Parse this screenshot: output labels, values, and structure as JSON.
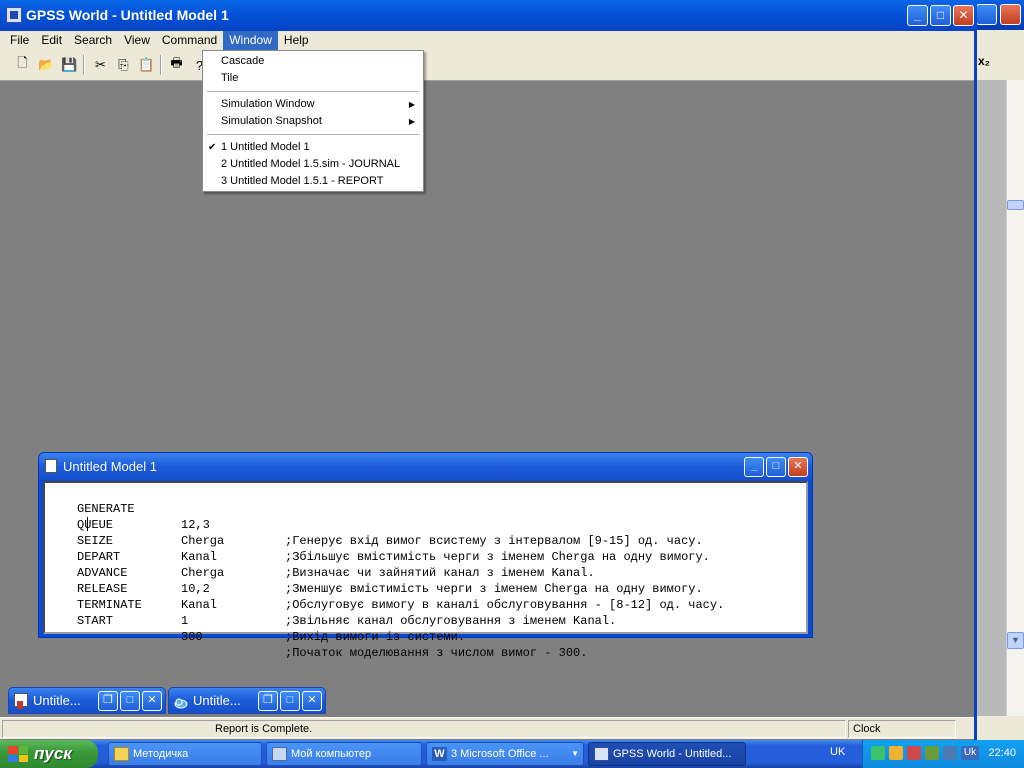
{
  "main_window": {
    "title": "GPSS World - Untitled Model 1",
    "menus": [
      "File",
      "Edit",
      "Search",
      "View",
      "Command",
      "Window",
      "Help"
    ],
    "active_menu": "Window"
  },
  "toolbar": {
    "icons": [
      "new-file-icon",
      "open-folder-icon",
      "save-icon",
      "cut-icon",
      "copy-icon",
      "paste-icon",
      "print-icon",
      "help-icon"
    ]
  },
  "window_menu": {
    "cascade": "Cascade",
    "tile": "Tile",
    "simulation_window": "Simulation Window",
    "simulation_snapshot": "Simulation Snapshot",
    "win1": "1 Untitled Model 1",
    "win2": "2 Untitled Model 1.5.sim  -  JOURNAL",
    "win3": "3 Untitled Model 1.5.1  -  REPORT",
    "checked": "1 Untitled Model 1"
  },
  "model_window": {
    "title": "Untitled Model 1",
    "lines": [
      {
        "op": "GENERATE",
        "arg": "12,3",
        "comment": ";Генерує вхід вимог всистему з інтервалом [9-15] од. часу."
      },
      {
        "op": "QUEUE",
        "arg": "Cherga",
        "comment": ";Збільшує вмістимість черги з іменем Cherga на одну вимогу."
      },
      {
        "op": "SEIZE",
        "arg": "Kanal",
        "comment": ";Визначає чи зайнятий канал з іменем Kanal."
      },
      {
        "op": "DEPART",
        "arg": "Cherga",
        "comment": ";Зменшує вмістимість черги з іменем Cherga на одну вимогу."
      },
      {
        "op": "ADVANCE",
        "arg": "10,2",
        "comment": ";Обслуговує вимогу в каналі обслуговування - [8-12] од. часу."
      },
      {
        "op": "RELEASE",
        "arg": "Kanal",
        "comment": ";Звільняє канал обслуговування з іменем Kanal."
      },
      {
        "op": "TERMINATE",
        "arg": "1",
        "comment": ";Вихід вимоги із системи."
      },
      {
        "op": "START",
        "arg": "300",
        "comment": ";Початок моделювання з числом вимог - 300."
      }
    ]
  },
  "minimized": [
    {
      "title": "Untitle...",
      "icon": "report-icon"
    },
    {
      "title": "Untitle...",
      "icon": "simulation-icon"
    }
  ],
  "status": {
    "message": "Report is Complete.",
    "clock_label": "Clock"
  },
  "taskbar": {
    "start": "пуск",
    "tasks": [
      {
        "label": "Методичка",
        "icon": "folder-icon",
        "active": false
      },
      {
        "label": "Мой компьютер",
        "icon": "computer-icon",
        "active": false
      },
      {
        "label": "3 Microsoft Office ...",
        "icon": "word-icon",
        "active": false
      },
      {
        "label": "GPSS World - Untitled...",
        "icon": "gpss-icon",
        "active": true
      }
    ],
    "language": "UK",
    "tray_language": "Uk",
    "time": "22:40"
  },
  "colors": {
    "titlebar_blue": "#0452d8",
    "menu_highlight": "#316ac5",
    "mdi_background": "#808080",
    "start_green": "#3a9a3a"
  }
}
